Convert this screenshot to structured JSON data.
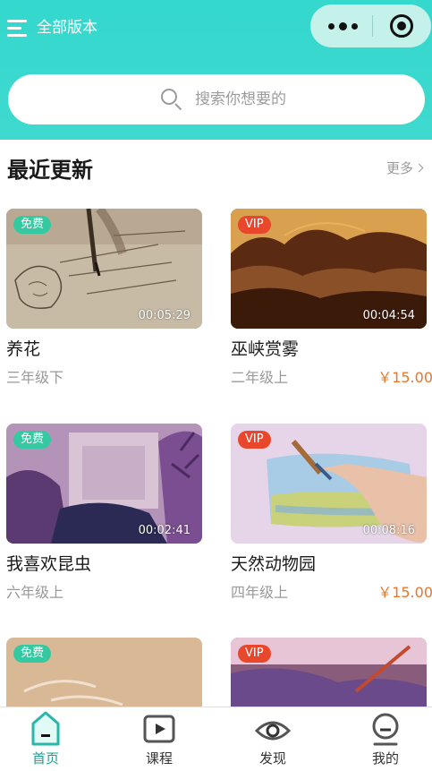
{
  "header": {
    "version_label": "全部版本",
    "search_placeholder": "搜索你想要的"
  },
  "section": {
    "title": "最近更新",
    "more": "更多"
  },
  "courses": [
    {
      "title": "养花",
      "grade": "三年级下",
      "badge": "免费",
      "duration": "00:05:29",
      "price": ""
    },
    {
      "title": "巫峡赏雾",
      "grade": "二年级上",
      "badge": "VIP",
      "duration": "00:04:54",
      "price": "￥15.00"
    },
    {
      "title": "我喜欢昆虫",
      "grade": "六年级上",
      "badge": "免费",
      "duration": "00:02:41",
      "price": ""
    },
    {
      "title": "天然动物园",
      "grade": "四年级上",
      "badge": "VIP",
      "duration": "00:08:16",
      "price": "￥15.00"
    },
    {
      "title": "",
      "grade": "",
      "badge": "免费",
      "duration": "",
      "price": ""
    },
    {
      "title": "",
      "grade": "",
      "badge": "VIP",
      "duration": "",
      "price": ""
    }
  ],
  "tabs": [
    {
      "label": "首页",
      "icon": "home-icon",
      "active": true
    },
    {
      "label": "课程",
      "icon": "play-icon",
      "active": false
    },
    {
      "label": "发现",
      "icon": "eye-icon",
      "active": false
    },
    {
      "label": "我的",
      "icon": "profile-icon",
      "active": false
    }
  ],
  "colors": {
    "accent": "#34d8cd",
    "active_tab": "#1e9e93",
    "free_badge": "#34c9a0",
    "vip_badge": "#e8472c",
    "price": "#e8752c"
  }
}
